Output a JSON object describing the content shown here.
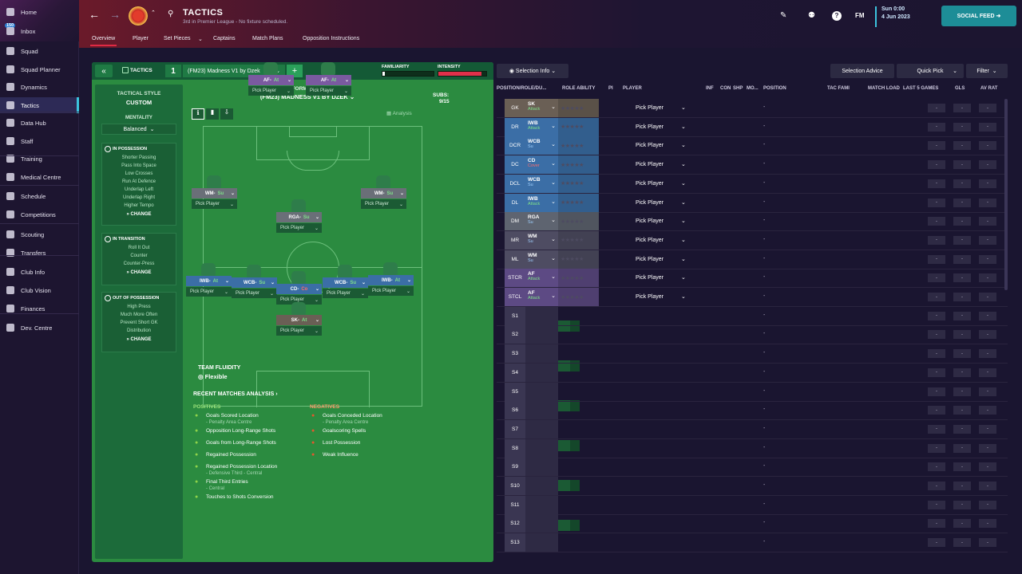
{
  "sidebar": {
    "items": [
      {
        "label": "Home"
      },
      {
        "label": "Inbox",
        "badge": "150"
      },
      {
        "label": "Squad"
      },
      {
        "label": "Squad Planner"
      },
      {
        "label": "Dynamics"
      },
      {
        "label": "Tactics"
      },
      {
        "label": "Data Hub"
      },
      {
        "label": "Staff"
      },
      {
        "label": "Training"
      },
      {
        "label": "Medical Centre"
      },
      {
        "label": "Schedule"
      },
      {
        "label": "Competitions"
      },
      {
        "label": "Scouting"
      },
      {
        "label": "Transfers"
      },
      {
        "label": "Club Info"
      },
      {
        "label": "Club Vision"
      },
      {
        "label": "Finances"
      },
      {
        "label": "Dev. Centre"
      }
    ],
    "active": "Tactics"
  },
  "header": {
    "title": "TACTICS",
    "subtitle": "3rd in Premier League - No fixture scheduled.",
    "date_line1": "Sun 0:00",
    "date_line2": "4 Jun 2023",
    "social": "SOCIAL FEED",
    "fm": "FM",
    "tabs": [
      "Overview",
      "Player",
      "Set Pieces",
      "Captains",
      "Match Plans",
      "Opposition Instructions"
    ],
    "active_tab": "Overview"
  },
  "tactic": {
    "label": "TACTICS",
    "number": "1",
    "name": "(FM23) Madness V1 by Dzek",
    "familiarity_label": "FAMILIARITY",
    "intensity_label": "INTENSITY",
    "familiarity": 0.05,
    "intensity": 0.9,
    "formation_label": "FORMATION",
    "formation_name": "(FM23) MADNESS V1 BY DZEK",
    "subs_label": "SUBS:",
    "subs_value": "9/15",
    "analysis": "Analysis",
    "style_label": "TACTICAL STYLE",
    "style_value": "CUSTOM",
    "mentality_label": "MENTALITY",
    "mentality": "Balanced",
    "in_possession": {
      "head": "IN POSSESSION",
      "lines": [
        "Shorter Passing",
        "Pass Into Space",
        "Low Crosses",
        "Run At Defence",
        "Underlap Left",
        "Underlap Right",
        "Higher Tempo"
      ],
      "change": "CHANGE"
    },
    "in_transition": {
      "head": "IN TRANSITION",
      "lines": [
        "Roll It Out",
        "Counter",
        "Counter-Press"
      ],
      "change": "CHANGE"
    },
    "out_possession": {
      "head": "OUT OF POSSESSION",
      "lines": [
        "High Press",
        "Much More Often",
        "Prevent Short GK",
        "Distribution"
      ],
      "change": "CHANGE"
    },
    "fluidity_label": "TEAM FLUIDITY",
    "fluidity": "Flexible",
    "slots": [
      {
        "role": "AF",
        "duty": "At",
        "kind": "att",
        "pick": "Pick Player"
      },
      {
        "role": "AF",
        "duty": "At",
        "kind": "att",
        "pick": "Pick Player"
      },
      {
        "role": "WM",
        "duty": "Su",
        "kind": "mid",
        "pick": "Pick Player"
      },
      {
        "role": "WM",
        "duty": "Su",
        "kind": "mid",
        "pick": "Pick Player"
      },
      {
        "role": "RGA",
        "duty": "Su",
        "kind": "mid",
        "pick": "Pick Player"
      },
      {
        "role": "IWB",
        "duty": "At",
        "kind": "def",
        "pick": "Pick Player"
      },
      {
        "role": "WCB",
        "duty": "Su",
        "kind": "def",
        "pick": "Pick Player"
      },
      {
        "role": "CD",
        "duty": "Co",
        "kind": "def",
        "pick": "Pick Player",
        "red": true
      },
      {
        "role": "WCB",
        "duty": "Su",
        "kind": "def",
        "pick": "Pick Player"
      },
      {
        "role": "IWB",
        "duty": "At",
        "kind": "def",
        "pick": "Pick Player"
      },
      {
        "role": "SK",
        "duty": "At",
        "kind": "gk",
        "pick": "Pick Player"
      }
    ],
    "sub_pick": "Pick Player",
    "recent": "RECENT MATCHES ANALYSIS",
    "positives_label": "POSITIVES",
    "negatives_label": "NEGATIVES",
    "positives": [
      {
        "t": "Goals Scored Location",
        "s": "- Penalty Area Centre"
      },
      {
        "t": "Opposition Long-Range Shots"
      },
      {
        "t": "Goals from Long-Range Shots"
      },
      {
        "t": "Regained Possession"
      },
      {
        "t": "Regained Possession Location",
        "s": "- Defensive Third - Central"
      },
      {
        "t": "Final Third Entries",
        "s": "- Central"
      },
      {
        "t": "Touches to Shots Conversion"
      }
    ],
    "negatives": [
      {
        "t": "Goals Conceded Location",
        "s": "- Penalty Area Centre"
      },
      {
        "t": "Goalscoring Spells"
      },
      {
        "t": "Lost Possession"
      },
      {
        "t": "Weak Influence"
      }
    ]
  },
  "table": {
    "selection_info": "Selection Info",
    "selection_advice": "Selection Advice",
    "quick_pick": "Quick Pick",
    "filter": "Filter",
    "headers": [
      "POSITION/ROLE/DU...",
      "ROLE ABILITY",
      "PI",
      "PLAYER",
      "INF",
      "CON",
      "SHP",
      "MO...",
      "POSITION",
      "TAC FAMI",
      "MATCH LOAD",
      "LAST 5 GAMES",
      "GLS",
      "AV RAT"
    ],
    "pick": "Pick Player",
    "dash": "-",
    "rows": [
      {
        "pos": "GK",
        "role": "SK",
        "duty": "Attack",
        "color": "#6a5f55",
        "dc": "#7fe08a"
      },
      {
        "pos": "DR",
        "role": "IWB",
        "duty": "Attack",
        "color": "#3b6ea6",
        "dc": "#7fe08a"
      },
      {
        "pos": "DCR",
        "role": "WCB",
        "duty": "Su",
        "color": "#3b6ea6",
        "dc": "#9fd0ff"
      },
      {
        "pos": "DC",
        "role": "CD",
        "duty": "Cover",
        "color": "#3b6ea6",
        "dc": "#ff6b6b"
      },
      {
        "pos": "DCL",
        "role": "WCB",
        "duty": "Su",
        "color": "#3b6ea6",
        "dc": "#9fd0ff"
      },
      {
        "pos": "DL",
        "role": "IWB",
        "duty": "Attack",
        "color": "#3b6ea6",
        "dc": "#7fe08a"
      },
      {
        "pos": "DM",
        "role": "RGA",
        "duty": "Su",
        "color": "#5e6470",
        "dc": "#9fd0ff"
      },
      {
        "pos": "MR",
        "role": "WM",
        "duty": "Su",
        "color": "#4e4c62",
        "dc": "#9fd0ff"
      },
      {
        "pos": "ML",
        "role": "WM",
        "duty": "Su",
        "color": "#4e4c62",
        "dc": "#9fd0ff"
      },
      {
        "pos": "STCR",
        "role": "AF",
        "duty": "Attack",
        "color": "#5d4a84",
        "dc": "#7fe08a"
      },
      {
        "pos": "STCL",
        "role": "AF",
        "duty": "Attack",
        "color": "#5d4a84",
        "dc": "#7fe08a"
      },
      {
        "pos": "S1"
      },
      {
        "pos": "S2"
      },
      {
        "pos": "S3"
      },
      {
        "pos": "S4"
      },
      {
        "pos": "S5"
      },
      {
        "pos": "S6"
      },
      {
        "pos": "S7"
      },
      {
        "pos": "S8"
      },
      {
        "pos": "S9"
      },
      {
        "pos": "S10"
      },
      {
        "pos": "S11"
      },
      {
        "pos": "S12"
      },
      {
        "pos": "S13"
      }
    ]
  }
}
